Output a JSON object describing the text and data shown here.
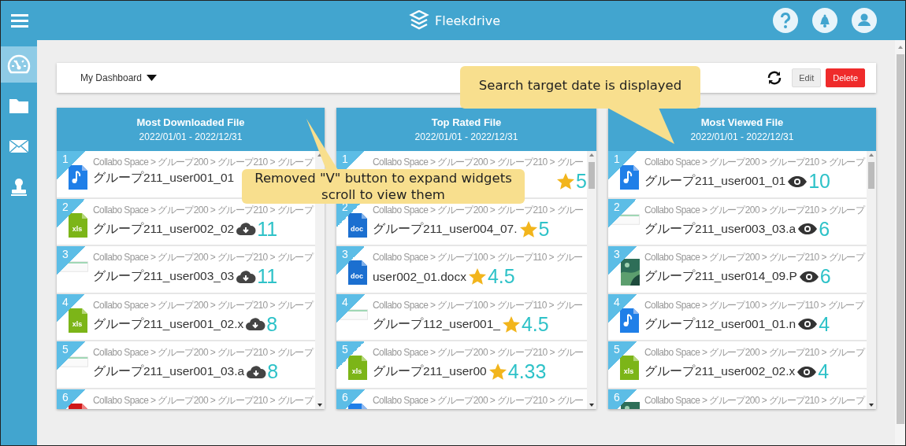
{
  "top_bar": {
    "app_name": "Fleekdrive"
  },
  "sidebar": {
    "items": [
      {
        "kind": "dashboard",
        "selected": true
      },
      {
        "kind": "folder",
        "selected": false
      },
      {
        "kind": "mail",
        "selected": false
      },
      {
        "kind": "stamp",
        "selected": false
      }
    ]
  },
  "dashboard": {
    "title": "My Dashboard",
    "buttons": [
      {
        "label": "Edit",
        "kind": "normal"
      },
      {
        "label": "Delete",
        "kind": "danger"
      }
    ]
  },
  "widgets": [
    {
      "title": "Most Downloaded File",
      "period": "2022/01/01 - 2022/12/31",
      "kind": "downloads",
      "rows": [
        {
          "rank": "1",
          "path": "Collabo Space > グループ200 > グループ210 > グループ",
          "name": "グループ211_user001_01",
          "kind": "audio"
        },
        {
          "rank": "2",
          "path": "Collabo Space > グループ200 > グループ210 > グループ",
          "name": "グループ211_user002_02",
          "kind": "xls",
          "icon_label": "xls",
          "count": "11"
        },
        {
          "rank": "3",
          "path": "Collabo Space > グループ200 > グループ210 > グループ",
          "name": "グループ211_user003_03",
          "kind": "sheet",
          "count": "11"
        },
        {
          "rank": "4",
          "path": "Collabo Space > グループ200 > グループ210 > グループ",
          "name": "グループ211_user001_02.x",
          "kind": "xls",
          "icon_label": "xls",
          "count": "8"
        },
        {
          "rank": "5",
          "path": "Collabo Space > グループ200 > グループ210 > グループ",
          "name": "グループ211_user001_03.a",
          "kind": "sheet",
          "count": "8"
        },
        {
          "rank": "6",
          "path": "Collabo Space > グループ200 > グループ210 > グループ",
          "kind": "pdf"
        }
      ]
    },
    {
      "title": "Top Rated File",
      "period": "2022/01/01 - 2022/12/31",
      "kind": "rating",
      "rows": [
        {
          "rank": "1",
          "path": "Collabo Space > グループ200 > グループ210 > グルー",
          "count": "5"
        },
        {
          "rank": "2",
          "path": "Collabo Space > グループ200 > グループ210 > グルー",
          "name": "グループ211_user004_07.",
          "kind": "doc",
          "icon_label": "doc",
          "count": "5"
        },
        {
          "rank": "3",
          "path": "Collabo Space > グループ100 > グループ110 > グルー",
          "name": "user002_01.docx",
          "kind": "doc",
          "icon_label": "doc",
          "count": "4.5"
        },
        {
          "rank": "4",
          "path": "Collabo Space > グループ100 > グループ110 > グルー",
          "name": "グループ112_user001_",
          "kind": "sheet",
          "count": "4.5"
        },
        {
          "rank": "5",
          "path": "Collabo Space > グループ200 > グループ210 > グルー",
          "name": "グループ211_user00",
          "kind": "xls",
          "icon_label": "xls",
          "count": "4.33"
        },
        {
          "rank": "6",
          "path": "Collabo Space > グループ200 > グループ210 > グルー",
          "kind": "audio"
        }
      ]
    },
    {
      "title": "Most Viewed File",
      "period": "2022/01/01 - 2022/12/31",
      "kind": "views",
      "rows": [
        {
          "rank": "1",
          "path": "Collabo Space > グループ200 > グループ210 > グループ",
          "name": "グループ211_user001_01",
          "kind": "audio",
          "count": "10"
        },
        {
          "rank": "2",
          "path": "Collabo Space > グループ200 > グループ210 > グループ",
          "name": "グループ211_user003_03.a",
          "kind": "sheet",
          "count": "6"
        },
        {
          "rank": "3",
          "path": "Collabo Space > グループ200 > グループ210 > グループ",
          "name": "グループ211_user014_09.P",
          "kind": "photo",
          "count": "6"
        },
        {
          "rank": "4",
          "path": "Collabo Space > グループ100 > グループ110 > グループ",
          "name": "グループ112_user001_01.n",
          "kind": "audio",
          "count": "4"
        },
        {
          "rank": "5",
          "path": "Collabo Space > グループ200 > グループ210 > グループ",
          "name": "グループ211_user002_02.x",
          "kind": "xls",
          "icon_label": "xls",
          "count": "4"
        },
        {
          "rank": "6",
          "path": "Collabo Space > グループ200 > グループ210 > グループ",
          "kind": "photo"
        }
      ]
    }
  ],
  "annotations": [
    {
      "lines": [
        "Search target date is displayed"
      ]
    },
    {
      "lines": [
        "Removed \"V\" button to expand widgets",
        "scroll to view them"
      ]
    }
  ]
}
